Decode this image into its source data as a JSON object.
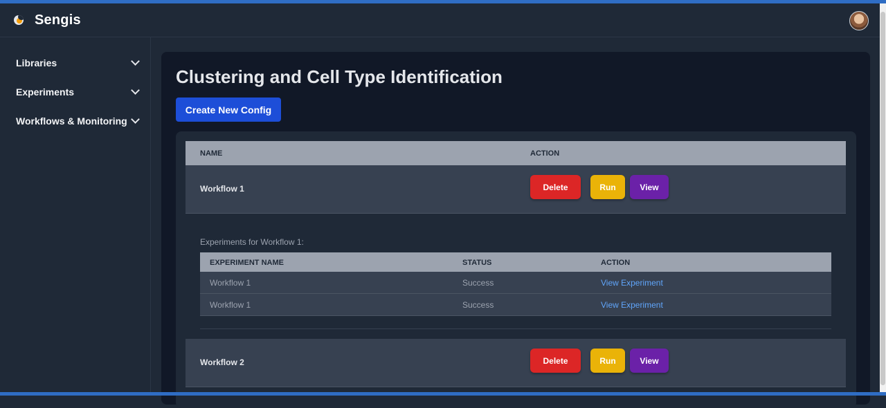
{
  "app": {
    "name": "Sengis"
  },
  "sidebar": {
    "items": [
      {
        "label": "Libraries"
      },
      {
        "label": "Experiments"
      },
      {
        "label": "Workflows & Monitoring"
      }
    ]
  },
  "main": {
    "title": "Clustering and Cell Type Identification",
    "create_button": "Create New Config",
    "table": {
      "headers": {
        "name": "NAME",
        "action": "ACTION"
      },
      "actions": {
        "delete": "Delete",
        "run": "Run",
        "view": "View"
      },
      "workflows": [
        {
          "name": "Workflow 1"
        },
        {
          "name": "Workflow 2"
        }
      ]
    },
    "experiments": {
      "caption": "Experiments for Workflow 1:",
      "headers": {
        "name": "EXPERIMENT NAME",
        "status": "STATUS",
        "action": "ACTION"
      },
      "rows": [
        {
          "name": "Workflow 1",
          "status": "Success",
          "action": "View Experiment"
        },
        {
          "name": "Workflow 1",
          "status": "Success",
          "action": "View Experiment"
        }
      ]
    }
  },
  "colors": {
    "primary": "#1d4ed8",
    "delete": "#dc2626",
    "run": "#eab308",
    "view": "#6b21a8",
    "link": "#60a5fa"
  }
}
